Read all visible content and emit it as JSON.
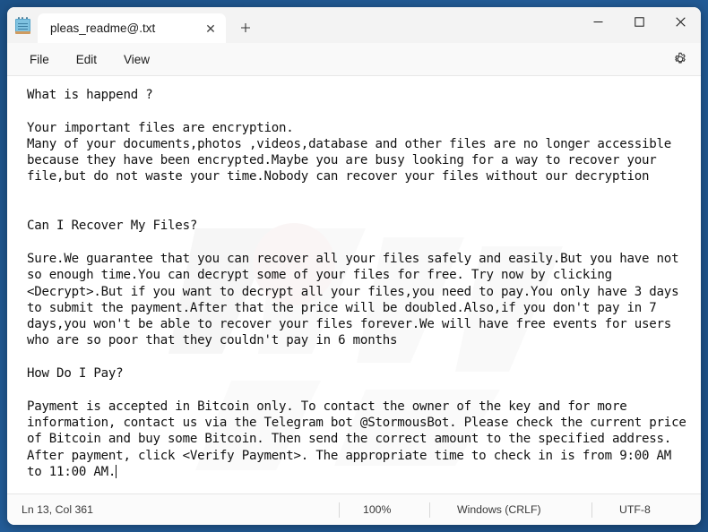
{
  "window": {
    "app_icon": "notepad-icon",
    "tab": {
      "label": "pleas_readme@.txt",
      "close_glyph": "✕"
    },
    "new_tab_glyph": "＋",
    "controls": {
      "minimize": "minimize-icon",
      "maximize": "maximize-icon",
      "close": "close-icon"
    }
  },
  "menu": {
    "items": [
      {
        "label": "File"
      },
      {
        "label": "Edit"
      },
      {
        "label": "View"
      }
    ],
    "settings_icon": "gear-icon"
  },
  "document": {
    "lines": [
      "What is happend ?",
      "",
      "Your important files are encryption.",
      "Many of your documents,photos ,videos,database and other files are no longer accessible",
      "because they have been encrypted.Maybe you are busy looking for a way to recover your",
      "file,but do not waste your time.Nobody can recover your files without our decryption",
      "",
      "",
      "Can I Recover My Files?",
      "",
      "Sure.We guarantee that you can recover all your files safely and easily.But you have not",
      "so enough time.You can decrypt some of your files for free. Try now by clicking",
      "<Decrypt>.But if you want to decrypt all your files,you need to pay.You only have 3 days",
      "to submit the payment.After that the price will be doubled.Also,if you don't pay in 7",
      "days,you won't be able to recover your files forever.We will have free events for users",
      "who are so poor that they couldn't pay in 6 months",
      "",
      "How Do I Pay?",
      "",
      "Payment is accepted in Bitcoin only. To contact the owner of the key and for more",
      "information, contact us via the Telegram bot @StormousBot. Please check the current price",
      "of Bitcoin and buy some Bitcoin. Then send the correct amount to the specified address.",
      "After payment, click <Verify Payment>. The appropriate time to check in is from 9:00 AM",
      "to 11:00 AM."
    ],
    "contact_handle": "@StormousBot",
    "decrypt_link": "<Decrypt>",
    "verify_link": "<Verify Payment>"
  },
  "status": {
    "position": "Ln 13, Col 361",
    "zoom": "100%",
    "line_ending": "Windows (CRLF)",
    "encoding": "UTF-8"
  },
  "colors": {
    "desktop": "#20558c",
    "titlebar": "#f3f3f3",
    "tab_active": "#ffffff",
    "menubar": "#f9f9f9",
    "editor_bg": "#ffffff",
    "text": "#111111",
    "statusbar": "#fbfbfb"
  }
}
